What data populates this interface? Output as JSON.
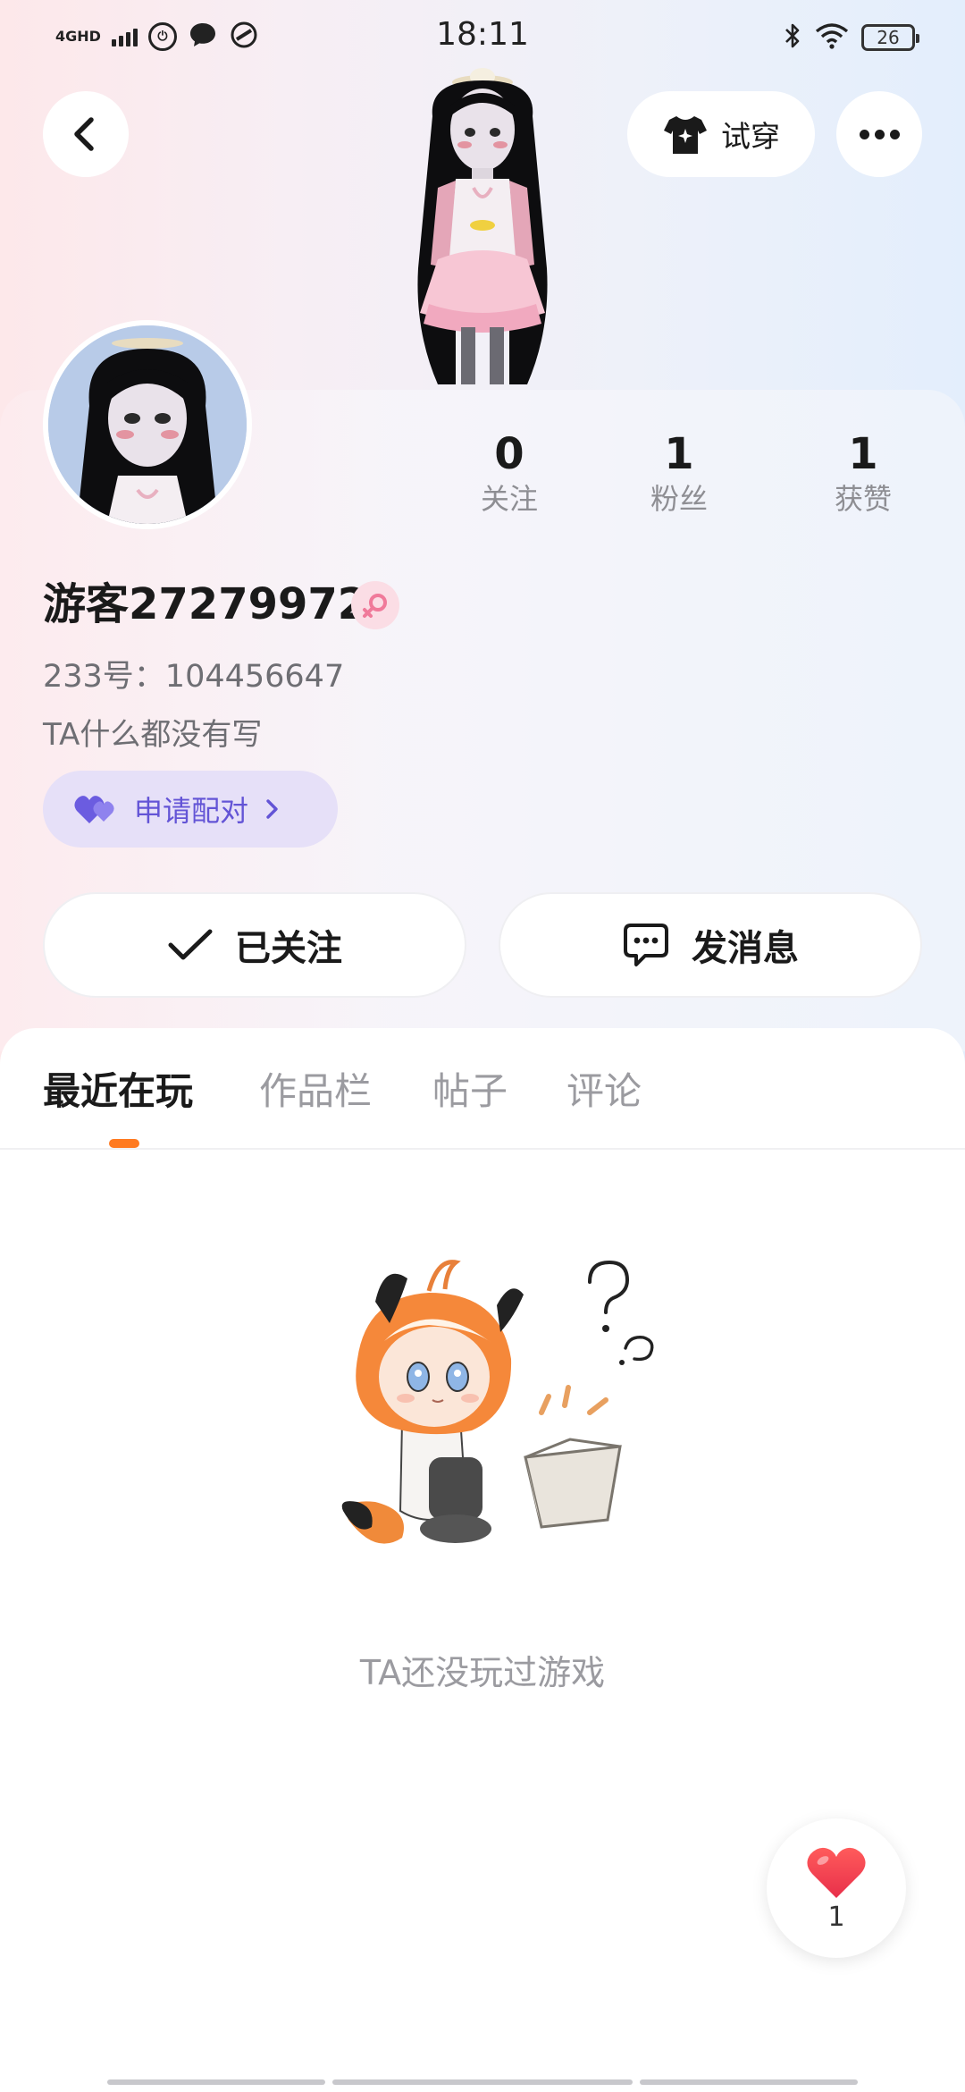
{
  "status_bar": {
    "network": "4G",
    "network_sub": "HD",
    "time": "18:11",
    "battery": "26"
  },
  "header": {
    "tryon_label": "试穿"
  },
  "profile": {
    "stats": [
      {
        "value": "0",
        "label": "关注"
      },
      {
        "value": "1",
        "label": "粉丝"
      },
      {
        "value": "1",
        "label": "获赞"
      }
    ],
    "username": "游客27279972",
    "uid": "233号：104456647",
    "bio": "TA什么都没有写",
    "pair_label": "申请配对"
  },
  "actions": {
    "follow_label": "已关注",
    "message_label": "发消息"
  },
  "tabs": [
    {
      "label": "最近在玩",
      "active": true
    },
    {
      "label": "作品栏",
      "active": false
    },
    {
      "label": "帖子",
      "active": false
    },
    {
      "label": "评论",
      "active": false
    }
  ],
  "empty_state": {
    "text": "TA还没玩过游戏"
  },
  "like_fab": {
    "count": "1"
  },
  "colors": {
    "accent_orange": "#ff7a20",
    "pair_purple": "#6354d6",
    "heart_red": "#f0454f",
    "gender_pink": "#f07a9a"
  }
}
